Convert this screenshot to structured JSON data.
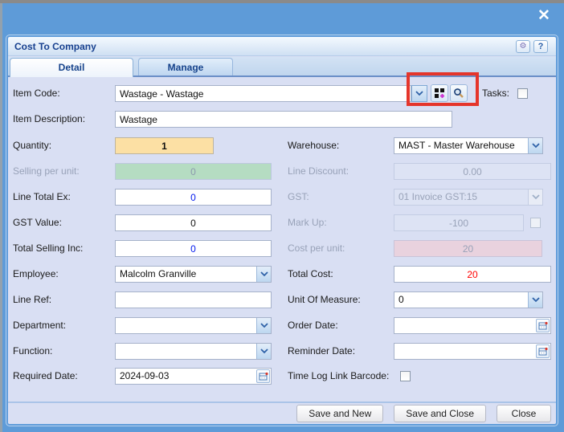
{
  "window": {
    "close_icon": "✕"
  },
  "dialog": {
    "title": "Cost To Company",
    "settings_icon": "⚙",
    "help_icon": "?",
    "tabs": [
      {
        "label": "Detail"
      },
      {
        "label": "Manage"
      }
    ]
  },
  "form": {
    "item_code": {
      "label": "Item Code:",
      "value": "Wastage - Wastage"
    },
    "tasks": {
      "label": "Tasks:"
    },
    "item_description": {
      "label": "Item Description:",
      "value": "Wastage"
    },
    "quantity": {
      "label": "Quantity:",
      "value": "1"
    },
    "warehouse": {
      "label": "Warehouse:",
      "value": "MAST - Master Warehouse"
    },
    "selling_per_unit": {
      "label": "Selling per unit:",
      "value": "0"
    },
    "line_discount": {
      "label": "Line Discount:",
      "value": "0.00"
    },
    "line_total_ex": {
      "label": "Line Total Ex:",
      "value": "0"
    },
    "gst": {
      "label": "GST:",
      "value": "01 Invoice GST:15"
    },
    "gst_value": {
      "label": "GST Value:",
      "value": "0"
    },
    "mark_up": {
      "label": "Mark Up:",
      "value": "-100"
    },
    "total_selling_inc": {
      "label": "Total Selling Inc:",
      "value": "0"
    },
    "cost_per_unit": {
      "label": "Cost per unit:",
      "value": "20"
    },
    "employee": {
      "label": "Employee:",
      "value": "Malcolm Granville"
    },
    "total_cost": {
      "label": "Total Cost:",
      "value": "20"
    },
    "line_ref": {
      "label": "Line Ref:",
      "value": ""
    },
    "unit_of_measure": {
      "label": "Unit Of Measure:",
      "value": "0"
    },
    "department": {
      "label": "Department:",
      "value": ""
    },
    "order_date": {
      "label": "Order Date:",
      "value": ""
    },
    "function": {
      "label": "Function:",
      "value": ""
    },
    "reminder_date": {
      "label": "Reminder Date:",
      "value": ""
    },
    "required_date": {
      "label": "Required Date:",
      "value": "2024-09-03"
    },
    "time_log_link_barcode": {
      "label": "Time Log Link Barcode:"
    }
  },
  "footer": {
    "save_and_new": "Save and New",
    "save_and_close": "Save and Close",
    "close": "Close"
  },
  "colors": {
    "background_blue": "#5e9bd8",
    "highlight_red": "#e5352b",
    "quantity_bg": "#fce0a4",
    "selling_bg": "#b5dcc2",
    "cost_bg": "#e9d2de",
    "value_blue": "#0018ee",
    "value_red": "#ff0000"
  }
}
